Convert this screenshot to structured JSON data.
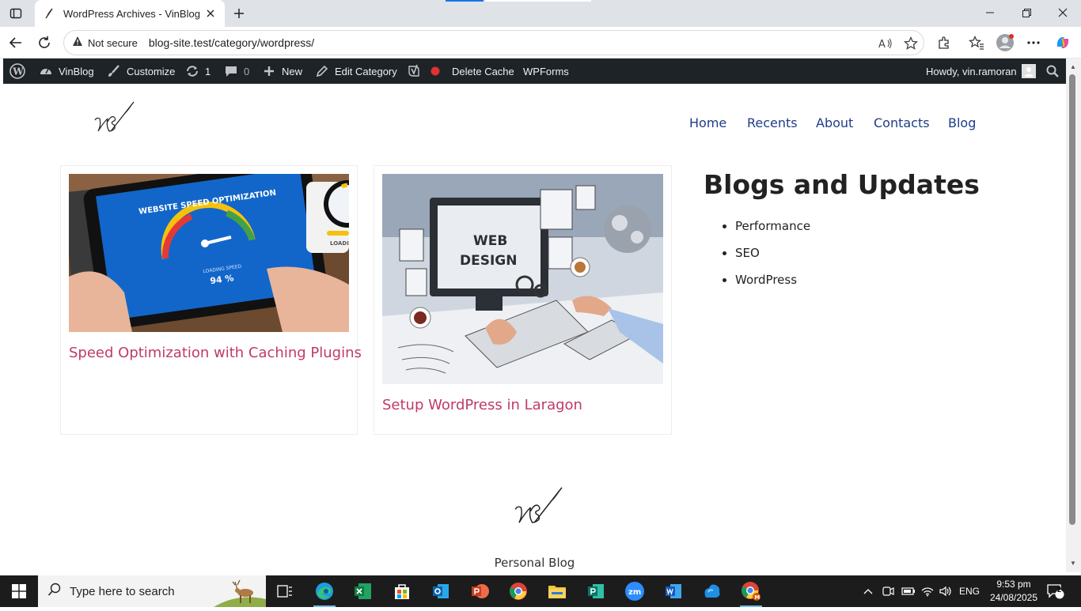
{
  "browser": {
    "tab_title": "WordPress Archives - VinBlog",
    "not_secure_label": "Not secure",
    "url": "blog-site.test/category/wordpress/"
  },
  "adminbar": {
    "site": "VinBlog",
    "customize": "Customize",
    "updates": "1",
    "comments": "0",
    "new": "New",
    "edit_category": "Edit Category",
    "delete_cache": "Delete Cache",
    "wpforms": "WPForms",
    "howdy": "Howdy, vin.ramoran"
  },
  "site": {
    "nav": [
      "Home",
      "Recents",
      "About",
      "Contacts",
      "Blog"
    ],
    "posts": [
      {
        "title": "Speed Optimization with Caching Plugins",
        "image_text": [
          "WEBSITE SPEED OPTIMIZATION",
          "LOADING SPEED",
          "94 %",
          "LOADI"
        ]
      },
      {
        "title": "Setup WordPress in Laragon",
        "image_text": [
          "WEB",
          "DESIGN"
        ]
      }
    ],
    "sidebar_title": "Blogs and Updates",
    "categories": [
      "Performance",
      "SEO",
      "WordPress"
    ],
    "footer_tagline": "Personal Blog"
  },
  "taskbar": {
    "search_placeholder": "Type here to search",
    "language": "ENG",
    "time": "9:53 pm",
    "date": "24/08/2025",
    "notifications": "2"
  },
  "colors": {
    "admin_bar": "#1d2327",
    "post_title": "#c0396a",
    "nav_link": "#1f3c88"
  }
}
